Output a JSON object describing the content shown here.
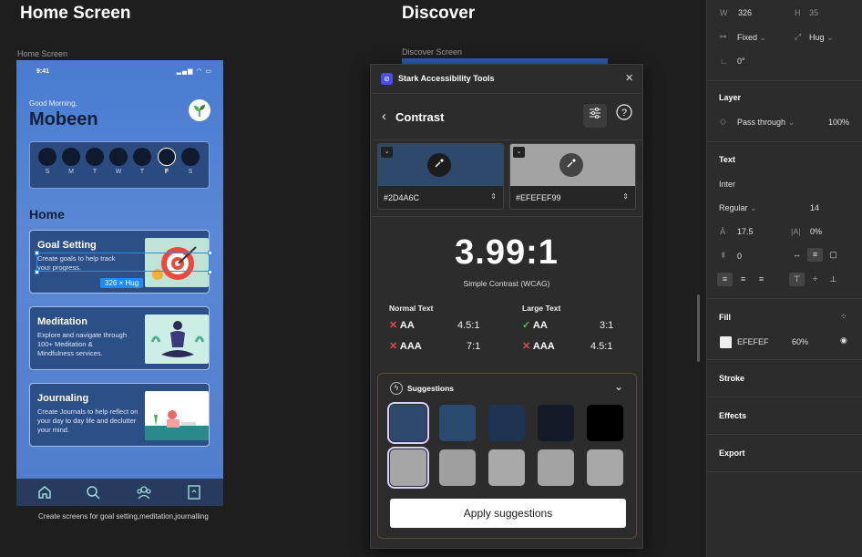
{
  "canvas": {
    "home_heading": "Home Screen",
    "discover_heading": "Discover",
    "home_frame_label": "Home Screen",
    "discover_frame_label": "Discover Screen",
    "caption": "Create screens for goal setting,meditation,journalling"
  },
  "phone": {
    "time": "9:41",
    "status_icons": "▂▄▆ ◠ ▭",
    "greeting": "Good Morning,",
    "name": "Mobeen",
    "week_days": [
      "S",
      "M",
      "T",
      "W",
      "T",
      "F",
      "S"
    ],
    "selected_day_index": 5,
    "home_title": "Home",
    "cards": [
      {
        "title": "Goal Setting",
        "desc": "Create goals to help track your progress."
      },
      {
        "title": "Meditation",
        "desc": "Explore and navigate through 100+ Meditation & Mindfulness services."
      },
      {
        "title": "Journaling",
        "desc": "Create Journals to help reflect on your day to day life and declutter your mind."
      }
    ],
    "hug_badge": "326 × Hug",
    "tabs": [
      "home-icon",
      "search-icon",
      "community-icon",
      "bookmark-icon"
    ]
  },
  "stark": {
    "title": "Stark Accessibility Tools",
    "section": "Contrast",
    "fg_color": "#2D4A6C",
    "bg_color": "#EFEFEF99",
    "fg_swatch": "#2d4a6c",
    "bg_swatch": "#a3a3a3",
    "ratio": "3.99:1",
    "ratio_label": "Simple Contrast (WCAG)",
    "normal_text_label": "Normal Text",
    "large_text_label": "Large Text",
    "normal": [
      {
        "status": "fail",
        "level": "AA",
        "req": "4.5:1"
      },
      {
        "status": "fail",
        "level": "AAA",
        "req": "7:1"
      }
    ],
    "large": [
      {
        "status": "pass",
        "level": "AA",
        "req": "3:1"
      },
      {
        "status": "fail",
        "level": "AAA",
        "req": "4.5:1"
      }
    ],
    "suggestions_label": "Suggestions",
    "suggestion_row1": [
      "#2d4a6c",
      "#2b4a70",
      "#1f3352",
      "#111a26",
      "#000000"
    ],
    "suggestion_row2": [
      "#a6a6a6",
      "#9f9f9f",
      "#a9a9a9",
      "#a3a3a3",
      "#a8a8a8"
    ],
    "apply_label": "Apply suggestions"
  },
  "panel": {
    "w_label": "W",
    "w_value": "326",
    "h_label": "H",
    "h_value": "35",
    "width_mode": "Fixed",
    "height_mode": "Hug",
    "rotation": "0°",
    "layer_title": "Layer",
    "blend_mode": "Pass through",
    "opacity": "100%",
    "text_title": "Text",
    "font": "Inter",
    "weight": "Regular",
    "size": "14",
    "line_height": "17.5",
    "letter_spacing": "0%",
    "paragraph_spacing": "0",
    "fill_title": "Fill",
    "fill_hex": "EFEFEF",
    "fill_opacity": "60%",
    "stroke_title": "Stroke",
    "effects_title": "Effects",
    "export_title": "Export"
  }
}
